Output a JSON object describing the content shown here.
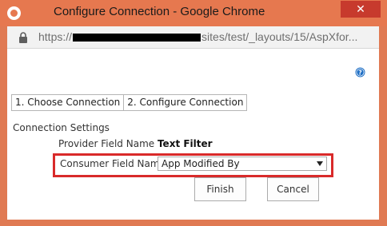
{
  "window": {
    "title": "Configure Connection - Google Chrome",
    "close_label": "✕"
  },
  "address": {
    "url_prefix": "https://",
    "url_suffix": "sites/test/_layouts/15/AspXfor..."
  },
  "tabs": [
    {
      "label": "1. Choose Connection"
    },
    {
      "label": "2. Configure Connection"
    }
  ],
  "connection_settings": {
    "heading": "Connection Settings",
    "provider_label": "Provider Field Name",
    "provider_value": "Text Filter",
    "consumer_label": "Consumer Field Name",
    "consumer_selected": "App Modified By"
  },
  "buttons": {
    "finish": "Finish",
    "cancel": "Cancel"
  },
  "colors": {
    "titlebar": "#e6784f",
    "close_button": "#c73a2d",
    "highlight": "#d92a2a",
    "help_icon": "#1f6fc5"
  },
  "icons": {
    "window": "chrome-icon",
    "address": "lock-icon",
    "help": "help-icon",
    "dropdown": "chevron-down-icon"
  }
}
